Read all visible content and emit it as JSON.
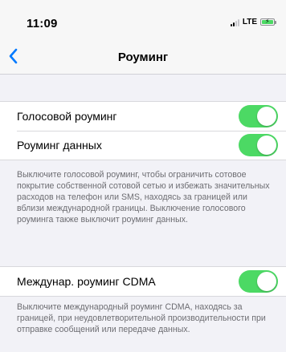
{
  "status_bar": {
    "time": "11:09",
    "network": "LTE",
    "signal_bars_active": 2,
    "signal_bars_total": 4,
    "battery_charging": true,
    "battery_color": "#4cd964"
  },
  "nav": {
    "back_icon": "chevron-left-icon",
    "title": "Роуминг",
    "accent": "#007aff"
  },
  "section1": {
    "rows": [
      {
        "label": "Голосовой роуминг",
        "on": true
      },
      {
        "label": "Роуминг данных",
        "on": true
      }
    ],
    "footer": "Выключите голосовой роуминг, чтобы ограничить сотовое покрытие собственной сотовой сетью и избежать значительных расходов на телефон или SMS, находясь за границей или вблизи международной границы. Выключение голосового роуминга также выключит роуминг данных."
  },
  "section2": {
    "rows": [
      {
        "label": "Междунар. роуминг CDMA",
        "on": true
      }
    ],
    "footer": "Выключите международный роуминг CDMA, находясь за границей, при неудовлетворительной производительности при отправке сообщений или передаче данных."
  },
  "toggle_on_color": "#4cd964"
}
